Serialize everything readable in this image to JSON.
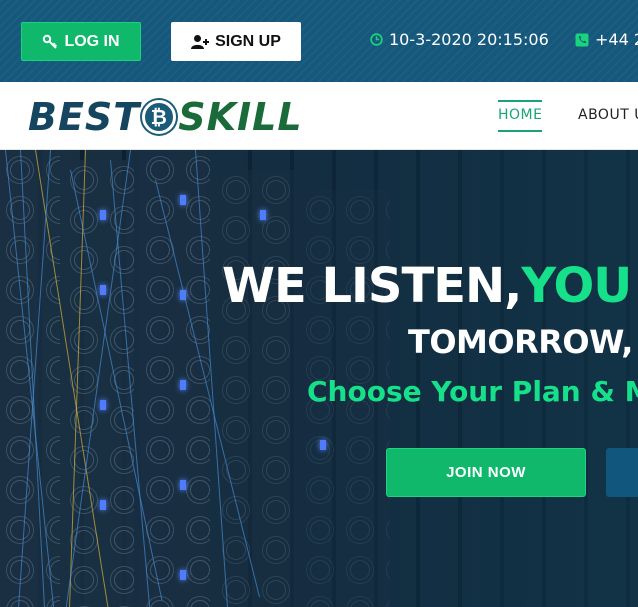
{
  "topbar": {
    "login_label": "LOG IN",
    "signup_label": "SIGN UP",
    "datetime": "10-3-2020 20:15:06",
    "phone": "+44 2"
  },
  "logo": {
    "part1": "BEST",
    "coin_symbol": "₿",
    "part2": "SKILL"
  },
  "nav": {
    "home": "HOME",
    "about": "ABOUT U"
  },
  "hero": {
    "headline_white": "WE LISTEN,",
    "headline_green": "YOU PR",
    "subheadline": "TOMORROW, TO",
    "tagline": "Choose Your Plan & Ma",
    "join_label": "JOIN NOW"
  },
  "colors": {
    "topbar_bg": "#15587c",
    "accent_green": "#0fb86b",
    "headline_green": "#17e08a",
    "logo_blue": "#16465f",
    "logo_green": "#1b6b3a"
  },
  "icons": {
    "login": "key-icon",
    "signup": "user-plus-icon",
    "datetime": "clock-icon",
    "phone": "phone-icon"
  }
}
